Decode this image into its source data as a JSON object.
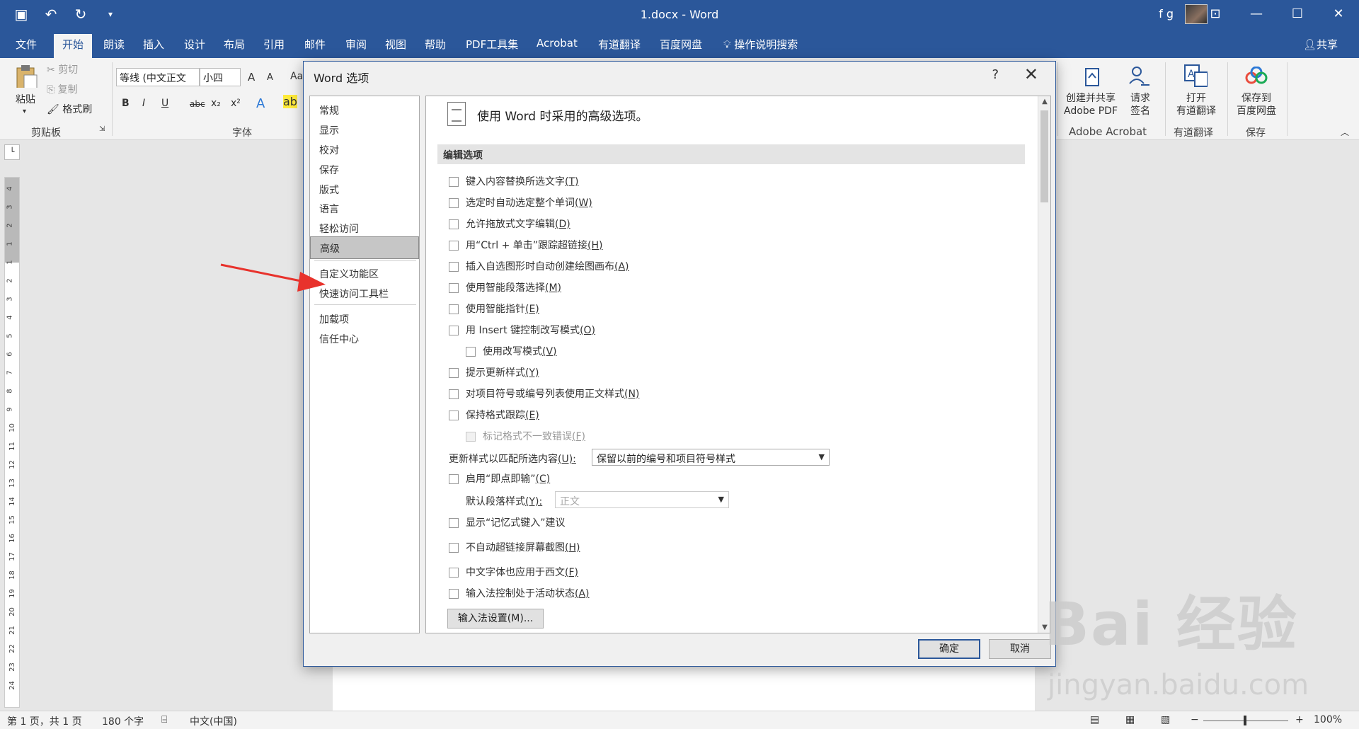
{
  "app": {
    "doc_title": "1.docx  -  Word",
    "account": "f g"
  },
  "tabs": [
    "文件",
    "开始",
    "朗读",
    "插入",
    "设计",
    "布局",
    "引用",
    "邮件",
    "审阅",
    "视图",
    "帮助",
    "PDF工具集",
    "Acrobat",
    "有道翻译",
    "百度网盘"
  ],
  "tell_me": "操作说明搜索",
  "share": "共享",
  "ribbon": {
    "paste": "粘贴",
    "cut": "剪切",
    "copy": "复制",
    "format_painter": "格式刷",
    "clipboard_group": "剪贴板",
    "font_name": "等线 (中文正文",
    "font_size": "小四",
    "font_group": "字体",
    "bold": "B",
    "italic": "I",
    "underline": "U",
    "strike": "abc",
    "subscript": "x₂",
    "superscript": "x²",
    "grow": "A",
    "shrink": "A",
    "aa": "Aa",
    "acrobat_btn1": [
      "创建并共享",
      "Adobe PDF"
    ],
    "acrobat_btn2": [
      "请求",
      "签名"
    ],
    "acrobat_group": "Adobe Acrobat",
    "youdao_btn": [
      "打开",
      "有道翻译"
    ],
    "youdao_group": "有道翻译",
    "baidu_btn": [
      "保存到",
      "百度网盘"
    ],
    "baidu_group": "保存"
  },
  "ruler_numbers": [
    "4",
    "3",
    "2",
    "1",
    "1",
    "2",
    "3",
    "4",
    "5",
    "6",
    "7",
    "8",
    "9",
    "10",
    "11",
    "12",
    "13",
    "14",
    "15",
    "16",
    "17",
    "18",
    "19",
    "20",
    "21",
    "22",
    "23",
    "24"
  ],
  "status": {
    "page": "第 1 页，共 1 页",
    "words": "180 个字",
    "lang": "中文(中国)",
    "zoom": "100%",
    "zoom_level": 1.0
  },
  "dialog": {
    "title": "Word 选项",
    "help": "?",
    "close": "✕",
    "nav": [
      "常规",
      "显示",
      "校对",
      "保存",
      "版式",
      "语言",
      "轻松访问",
      "高级",
      "自定义功能区",
      "快速访问工具栏",
      "加载项",
      "信任中心"
    ],
    "selected_nav": "高级",
    "header": "使用 Word 时采用的高级选项。",
    "section": "编辑选项",
    "options": [
      {
        "label": "键入内容替换所选文字",
        "key": "(T)"
      },
      {
        "label": "选定时自动选定整个单词",
        "key": "(W)"
      },
      {
        "label": "允许拖放式文字编辑",
        "key": "(D)"
      },
      {
        "label": "用“Ctrl + 单击”跟踪超链接",
        "key": "(H)"
      },
      {
        "label": "插入自选图形时自动创建绘图画布",
        "key": "(A)"
      },
      {
        "label": "使用智能段落选择",
        "key": "(M)"
      },
      {
        "label": "使用智能指针",
        "key": "(E)"
      },
      {
        "label": "用 Insert 键控制改写模式",
        "key": "(O)"
      },
      {
        "label": "使用改写模式",
        "key": "(V)"
      },
      {
        "label": "提示更新样式",
        "key": "(Y)"
      },
      {
        "label": "对项目符号或编号列表使用正文样式",
        "key": "(N)"
      },
      {
        "label": "保持格式跟踪",
        "key": "(E)"
      },
      {
        "label": "标记格式不一致错误",
        "key": "(F)"
      }
    ],
    "update_style_label": "更新样式以匹配所选内容",
    "update_style_key": "(U):",
    "update_style_value": "保留以前的编号和项目符号样式",
    "instant_label": "启用“即点即输”",
    "instant_key": "(C)",
    "default_para_label": "默认段落样式",
    "default_para_key": "(Y):",
    "default_para_value": "正文",
    "memory_label": "显示“记忆式键入”建议",
    "no_autolink_label": "不自动超链接屏幕截图",
    "no_autolink_key": "(H)",
    "cn_font_label": "中文字体也应用于西文",
    "cn_font_key": "(F)",
    "ime_active_label": "输入法控制处于活动状态",
    "ime_active_key": "(A)",
    "ime_settings_btn": "输入法设置(M)...",
    "ok": "确定",
    "cancel": "取消"
  },
  "watermark": {
    "line1": "Bai 经验",
    "line2": "jingyan.baidu.com"
  },
  "colors": {
    "accent": "#2b579a",
    "arrow": "#e8322c"
  }
}
